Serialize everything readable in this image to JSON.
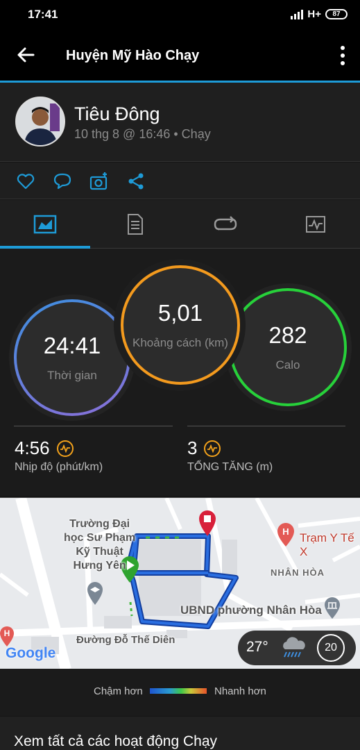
{
  "status_bar": {
    "time": "17:41",
    "network": "H+",
    "battery": "87"
  },
  "app_bar": {
    "title": "Huyện Mỹ Hào Chạy"
  },
  "header": {
    "user_name": "Tiêu Đông",
    "meta": "10 thg 8 @ 16:46 • Chạy"
  },
  "actions": [
    "heart-icon",
    "comment-icon",
    "camera-add-icon",
    "share-icon"
  ],
  "tabs": [
    "overview",
    "details",
    "laps",
    "charts"
  ],
  "stats": {
    "time": {
      "value": "24:41",
      "label": "Thời gian",
      "ring_color": "#3d8fe0"
    },
    "distance": {
      "value": "5,01",
      "label": "Khoảng cách (km)",
      "ring_color": "#f39a1e"
    },
    "calories": {
      "value": "282",
      "label": "Calo",
      "ring_color": "#27d13a"
    },
    "pace": {
      "value": "4:56",
      "label": "Nhịp độ (phút/km)"
    },
    "ascent": {
      "value": "3",
      "label": "TỔNG TĂNG (m)"
    }
  },
  "map": {
    "labels": {
      "school": [
        "Trường Đại",
        "học Sư Phạm",
        "Kỹ Thuật",
        "Hưng Yên"
      ],
      "clinic": "Trạm Y Tế X",
      "ward": "NHÂN HÒA",
      "office": "UBND phường Nhân Hòa",
      "street": "Đường Đỗ Thế Diên",
      "brand": "Google"
    },
    "weather": {
      "temperature": "27°",
      "wind": "20"
    }
  },
  "legend": {
    "slower": "Chậm hơn",
    "faster": "Nhanh hơn"
  },
  "footer": {
    "all_activities": "Xem tất cả các hoạt động Chạy"
  }
}
